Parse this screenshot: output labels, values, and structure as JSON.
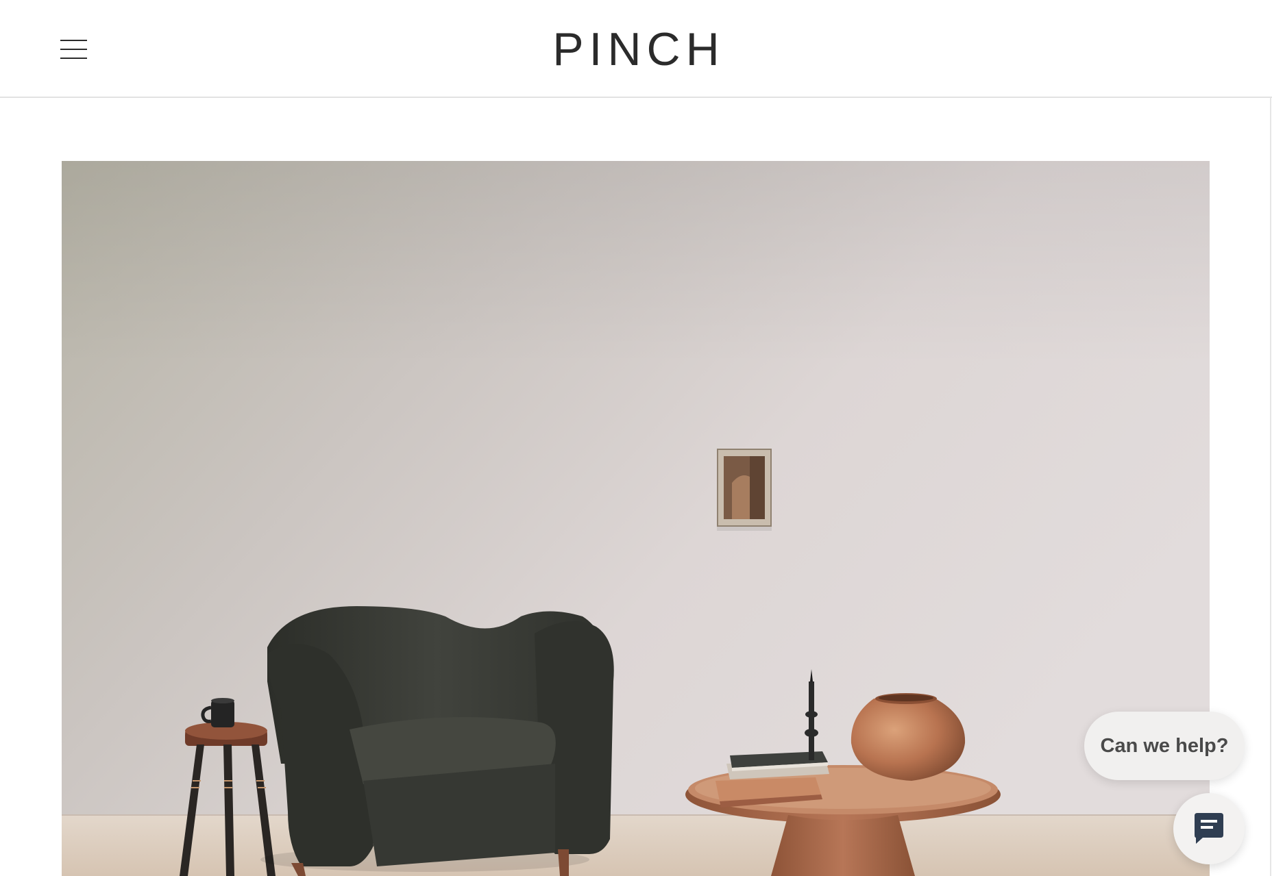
{
  "header": {
    "brand": "PINCH",
    "menu_icon": "hamburger-menu-icon"
  },
  "hero": {
    "image": "living-room-scene-with-dark-velvet-armchair-side-stool-and-round-coffee-table"
  },
  "chat_widget": {
    "prompt_label": "Can we help?",
    "icon": "chat-message-icon"
  },
  "colors": {
    "text_dark": "#2b2b2b",
    "chair_velvet": "#3a3c36",
    "wood": "#9a5c3f",
    "wall": "#d8d2cf"
  }
}
